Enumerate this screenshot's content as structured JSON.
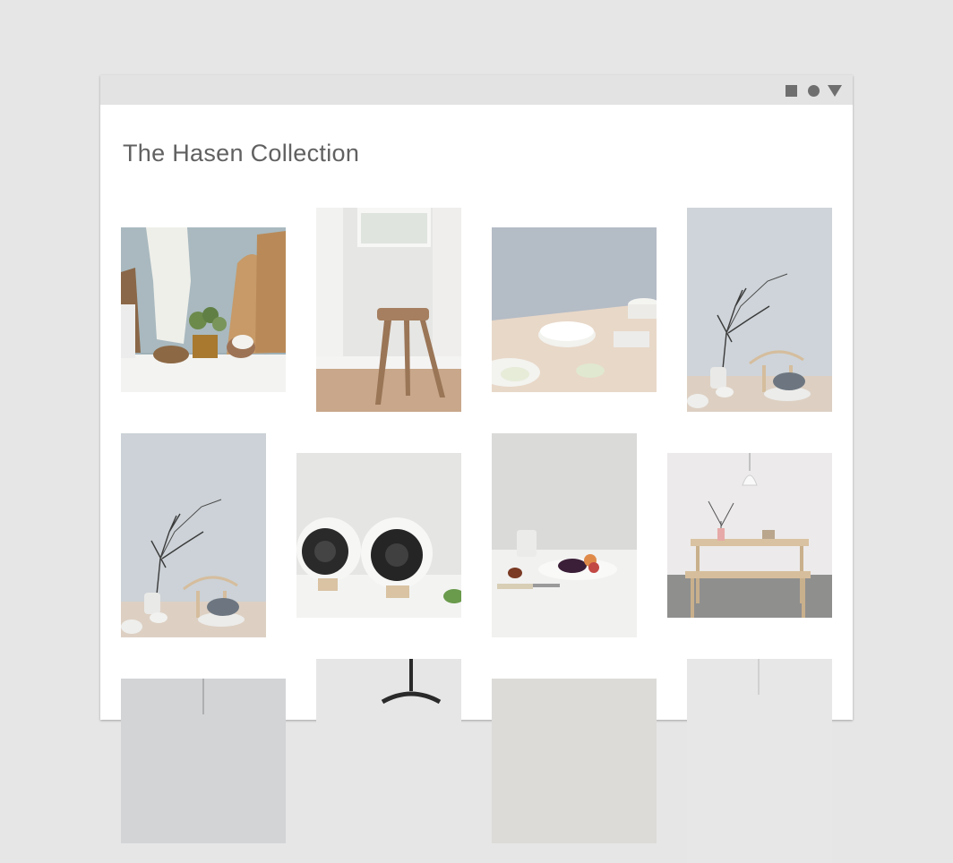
{
  "window": {
    "controls": [
      "square-icon",
      "circle-icon",
      "triangle-icon"
    ]
  },
  "header": {
    "title": "The Hasen Collection"
  },
  "gallery": {
    "photos": [
      "kitchen-still-life-photo",
      "wooden-stool-photo",
      "ceramic-dishes-table-photo",
      "branch-vase-chair-photo",
      "branch-vase-chair-photo-2",
      "ceramic-speakers-photo",
      "fruit-plate-knife-photo",
      "dining-table-bench-photo",
      "pendant-lamp-photo",
      "hanging-lamp-photo",
      "gray-interior-photo",
      "wall-pendant-photo"
    ]
  },
  "colors": {
    "background": "#e6e6e6",
    "titlebar": "#e3e3e3",
    "window": "#ffffff",
    "title_text": "#616161",
    "window_controls": "#6f6f6f"
  }
}
